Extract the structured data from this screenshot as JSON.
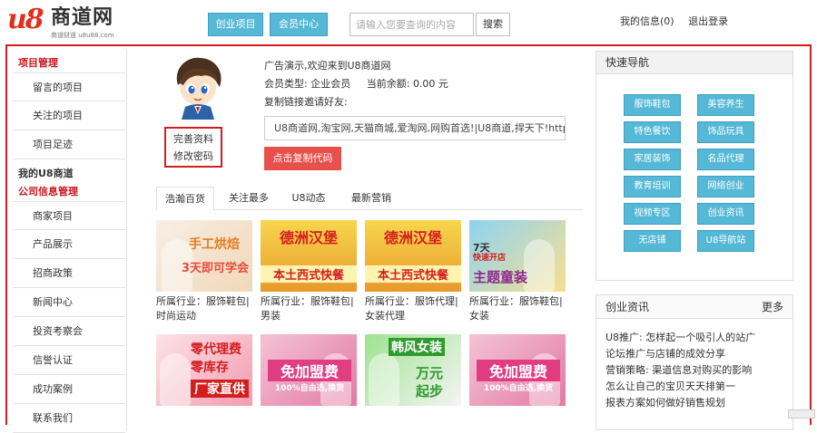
{
  "header": {
    "logo_mark": "u8",
    "logo_name": "商道网",
    "logo_slogan": "商道财道 u8u88.com",
    "nav": [
      "创业项目",
      "会员中心"
    ],
    "search_placeholder": "请输入您要查询的内容",
    "search_button": "搜索",
    "my_info": "我的信息(0)",
    "logout": "退出登录"
  },
  "sidebar": {
    "sections": [
      {
        "heading": "项目管理",
        "items": [
          "留言的项目",
          "关注的项目",
          "项目足迹"
        ]
      },
      {
        "heading": "我的U8商道",
        "items": []
      },
      {
        "heading": "公司信息管理",
        "items": [
          "商家项目",
          "产品展示",
          "招商政策",
          "新闻中心",
          "投资考察会",
          "信誉认证",
          "成功案例",
          "联系我们"
        ]
      }
    ]
  },
  "profile": {
    "links": [
      "完善资料",
      "修改密码"
    ]
  },
  "account": {
    "welcome": "广告演示,欢迎来到U8商道网",
    "member_type_label": "会员类型:",
    "member_type": "企业会员",
    "balance_label": "当前余额:",
    "balance": "0.00 元",
    "invite_label": "复制链接邀请好友:",
    "share_text": "U8商道网,淘宝网,天猫商城,爱淘网,网购首选!|U8商道,捍天下!http",
    "copy_button": "点击复制代码"
  },
  "tabs": [
    "浩瀚百货",
    "关注最多",
    "U8动态",
    "最新营销"
  ],
  "cards": [
    {
      "label": "所属行业：服饰鞋包|时尚运动",
      "banner": [
        "手工烘焙",
        "3天即可学会"
      ],
      "style": "bakery"
    },
    {
      "label": "所属行业：服饰鞋包|男装",
      "banner": [
        "德洲汉堡",
        "本土西式快餐"
      ],
      "style": "burger"
    },
    {
      "label": "所属行业：服饰代理|女装代理",
      "banner": [
        "德洲汉堡",
        "本土西式快餐"
      ],
      "style": "burger"
    },
    {
      "label": "所属行业：服饰鞋包|女装",
      "banner": [
        "7天",
        "快速开店",
        "主题童装"
      ],
      "style": "kids"
    },
    {
      "label": "",
      "banner": [
        "零代理费",
        "零库存",
        "厂家直供"
      ],
      "style": "zero"
    },
    {
      "label": "",
      "banner": [
        "免加盟费",
        "100%自由选,换货"
      ],
      "style": "free"
    },
    {
      "label": "",
      "banner": [
        "韩风女装",
        "万元",
        "起步"
      ],
      "style": "korean"
    },
    {
      "label": "",
      "banner": [
        "免加盟费",
        "100%自由选,换货"
      ],
      "style": "free"
    }
  ],
  "quick_nav": {
    "title": "快速导航",
    "buttons": [
      "服饰鞋包",
      "美容养生",
      "特色餐饮",
      "饰品玩具",
      "家居装饰",
      "名品代理",
      "教育培训",
      "网络创业",
      "视频专区",
      "创业资讯",
      "无店铺",
      "U8导航站"
    ]
  },
  "news": {
    "title": "创业资讯",
    "more": "更多",
    "items": [
      "U8推广: 怎样起一个吸引人的站广",
      "论坛推广与店铺的成效分享",
      "营销策略: 渠道信息对购买的影响",
      "怎么让自己的宝贝天天排第一",
      "报表方案如何做好销售规划"
    ]
  },
  "colors": {
    "frame_red": "#d41e1e",
    "nav_blue": "#55b8d6",
    "copy_button_red": "#e8514b"
  }
}
